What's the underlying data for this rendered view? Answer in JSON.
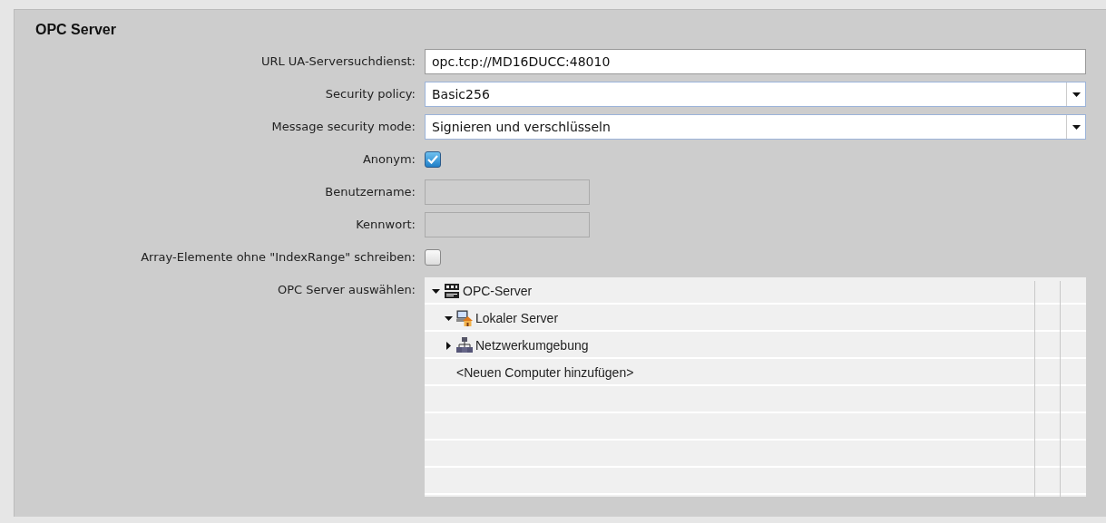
{
  "panel": {
    "title": "OPC Server"
  },
  "fields": [
    {
      "kind": "text",
      "label": "URL UA-Serversuchdienst:",
      "value": "opc.tcp://MD16DUCC:48010",
      "disabled": false
    },
    {
      "kind": "dropdown",
      "label": "Security policy:",
      "value": "Basic256"
    },
    {
      "kind": "dropdown",
      "label": "Message security mode:",
      "value": "Signieren und verschlüsseln"
    },
    {
      "kind": "checkbox",
      "label": "Anonym:",
      "checked": true
    },
    {
      "kind": "text",
      "label": "Benutzername:",
      "disabled": true
    },
    {
      "kind": "text",
      "label": "Kennwort:",
      "disabled": true
    },
    {
      "kind": "checkbox",
      "label": "Array-Elemente ohne \"IndexRange\" schreiben:",
      "checked": false
    },
    {
      "kind": "tree",
      "label": "OPC Server auswählen:"
    }
  ],
  "tree": [
    {
      "kind": "opc",
      "label": "OPC-Server",
      "expanded": true,
      "children": [
        {
          "kind": "local",
          "label": "Lokaler Server",
          "expanded": true
        },
        {
          "kind": "network",
          "label": "Netzwerkumgebung",
          "expanded": false
        },
        {
          "kind": "add",
          "label": "<Neuen Computer hinzufügen>"
        }
      ]
    }
  ]
}
